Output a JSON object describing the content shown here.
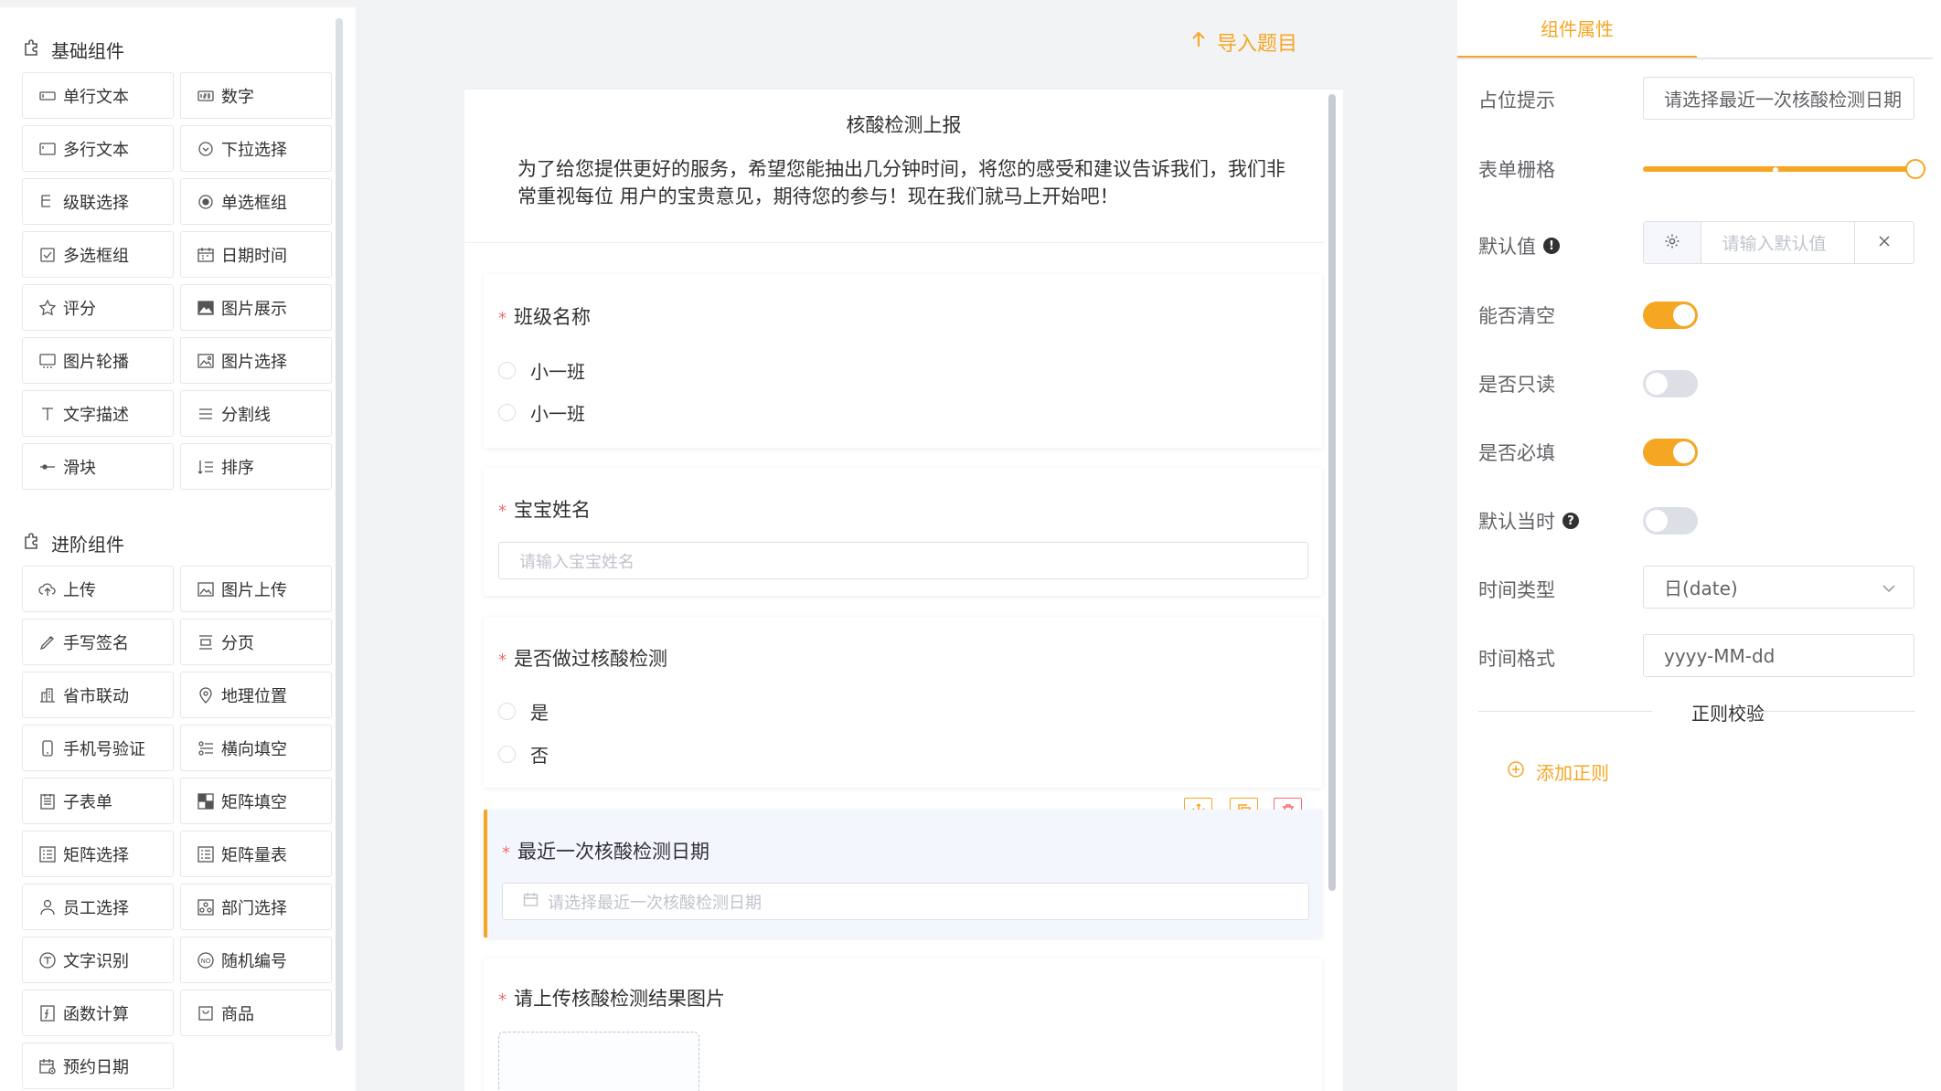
{
  "palette": {
    "basic_title": "基础组件",
    "basic_items": [
      {
        "label": "单行文本",
        "icon": "input-icon"
      },
      {
        "label": "数字",
        "icon": "number-icon"
      },
      {
        "label": "多行文本",
        "icon": "textarea-icon"
      },
      {
        "label": "下拉选择",
        "icon": "select-icon"
      },
      {
        "label": "级联选择",
        "icon": "cascader-icon"
      },
      {
        "label": "单选框组",
        "icon": "radio-icon"
      },
      {
        "label": "多选框组",
        "icon": "checkbox-icon"
      },
      {
        "label": "日期时间",
        "icon": "calendar-icon"
      },
      {
        "label": "评分",
        "icon": "star-icon"
      },
      {
        "label": "图片展示",
        "icon": "image-icon"
      },
      {
        "label": "图片轮播",
        "icon": "carousel-icon"
      },
      {
        "label": "图片选择",
        "icon": "image-select-icon"
      },
      {
        "label": "文字描述",
        "icon": "text-icon"
      },
      {
        "label": "分割线",
        "icon": "divider-icon"
      },
      {
        "label": "滑块",
        "icon": "slider-icon"
      },
      {
        "label": "排序",
        "icon": "sort-icon"
      }
    ],
    "advanced_title": "进阶组件",
    "advanced_items": [
      {
        "label": "上传",
        "icon": "upload-icon"
      },
      {
        "label": "图片上传",
        "icon": "image-upload-icon"
      },
      {
        "label": "手写签名",
        "icon": "signature-icon"
      },
      {
        "label": "分页",
        "icon": "pagination-icon"
      },
      {
        "label": "省市联动",
        "icon": "city-icon"
      },
      {
        "label": "地理位置",
        "icon": "location-icon"
      },
      {
        "label": "手机号验证",
        "icon": "phone-icon"
      },
      {
        "label": "横向填空",
        "icon": "fill-blank-icon"
      },
      {
        "label": "子表单",
        "icon": "subform-icon"
      },
      {
        "label": "矩阵填空",
        "icon": "matrix-fill-icon"
      },
      {
        "label": "矩阵选择",
        "icon": "matrix-select-icon"
      },
      {
        "label": "矩阵量表",
        "icon": "matrix-scale-icon"
      },
      {
        "label": "员工选择",
        "icon": "user-icon"
      },
      {
        "label": "部门选择",
        "icon": "department-icon"
      },
      {
        "label": "文字识别",
        "icon": "ocr-icon"
      },
      {
        "label": "随机编号",
        "icon": "random-number-icon"
      },
      {
        "label": "函数计算",
        "icon": "function-icon"
      },
      {
        "label": "商品",
        "icon": "product-icon"
      },
      {
        "label": "预约日期",
        "icon": "appointment-icon"
      }
    ]
  },
  "canvas": {
    "import_label": "导入题目",
    "form_title": "核酸检测上报",
    "form_desc": "为了给您提供更好的服务，希望您能抽出几分钟时间，将您的感受和建议告诉我们，我们非常重视每位 用户的宝贵意见，期待您的参与！现在我们就马上开始吧！",
    "fields": {
      "class_name": {
        "label": "班级名称",
        "options": [
          "小一班",
          "小一班"
        ]
      },
      "baby_name": {
        "label": "宝宝姓名",
        "placeholder": "请输入宝宝姓名"
      },
      "tested": {
        "label": "是否做过核酸检测",
        "options": [
          "是",
          "否"
        ]
      },
      "last_date": {
        "label": "最近一次核酸检测日期",
        "placeholder": "请选择最近一次核酸检测日期"
      },
      "upload": {
        "label": "请上传核酸检测结果图片"
      }
    },
    "required_mark": "*"
  },
  "properties": {
    "tab_label": "组件属性",
    "placeholder_label": "占位提示",
    "placeholder_value": "请选择最近一次核酸检测日期",
    "grid_label": "表单栅格",
    "grid_value": 24,
    "default_label": "默认值",
    "default_placeholder": "请输入默认值",
    "clearable_label": "能否清空",
    "clearable": true,
    "readonly_label": "是否只读",
    "readonly": false,
    "required_label": "是否必填",
    "required": true,
    "default_now_label": "默认当时",
    "default_now": false,
    "time_type_label": "时间类型",
    "time_type_value": "日(date)",
    "time_format_label": "时间格式",
    "time_format_value": "yyyy-MM-dd",
    "rule_title": "正则校验",
    "add_rule_label": "添加正则",
    "help_glyph": "?",
    "info_glyph": "!"
  },
  "colors": {
    "accent": "#f5a623",
    "required": "#f56c6c",
    "delete": "#f56c6c"
  }
}
